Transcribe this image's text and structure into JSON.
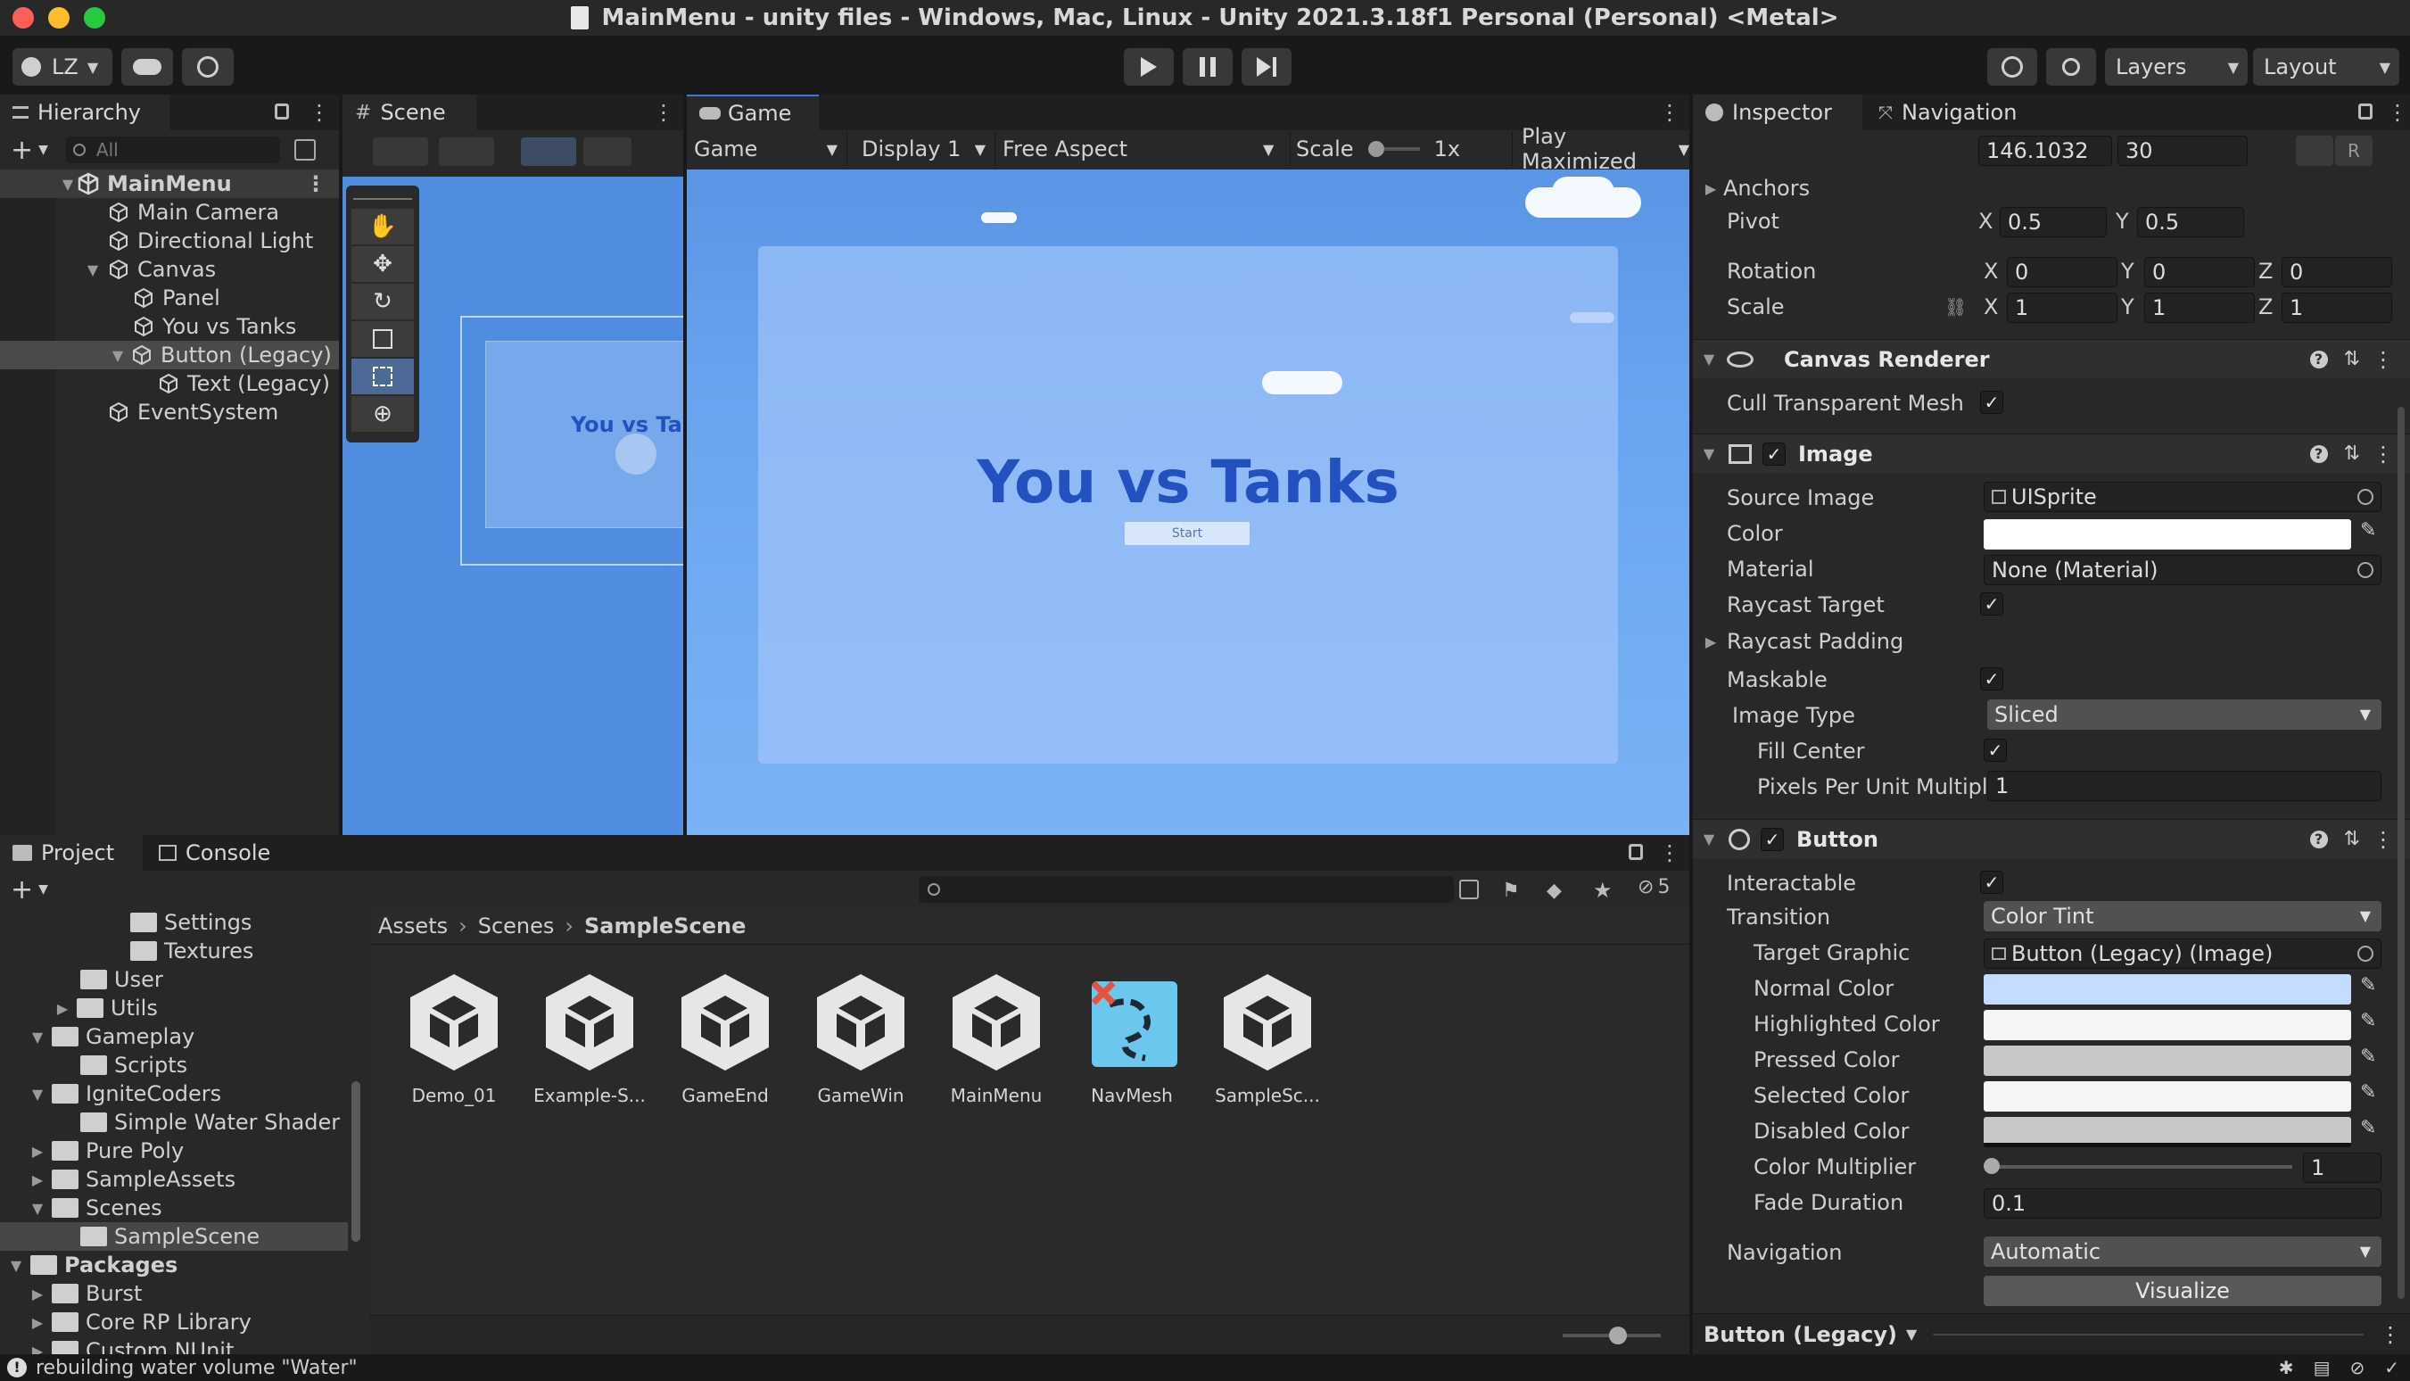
{
  "window": {
    "title": "MainMenu - unity files - Windows, Mac, Linux - Unity 2021.3.18f1 Personal (Personal) <Metal>"
  },
  "toolbar": {
    "account_label": "LZ",
    "layers_label": "Layers",
    "layout_label": "Layout"
  },
  "hierarchy": {
    "tab_label": "Hierarchy",
    "search_placeholder": "All",
    "items": [
      {
        "label": "MainMenu"
      },
      {
        "label": "Main Camera"
      },
      {
        "label": "Directional Light"
      },
      {
        "label": "Canvas"
      },
      {
        "label": "Panel"
      },
      {
        "label": "You vs Tanks"
      },
      {
        "label": "Button (Legacy)"
      },
      {
        "label": "Text (Legacy)"
      },
      {
        "label": "EventSystem"
      }
    ]
  },
  "scene": {
    "tab_label": "Scene",
    "preview_text": "You vs Tar"
  },
  "game": {
    "tab_label": "Game",
    "mode_dropdown": "Game",
    "display_dropdown": "Display 1",
    "aspect_dropdown": "Free Aspect",
    "scale_label": "Scale",
    "scale_value": "1x",
    "play_mode_dropdown": "Play Maximized",
    "ui_title": "You vs Tanks",
    "ui_button": "Start"
  },
  "project": {
    "tab_label": "Project",
    "console_tab_label": "Console",
    "hidden_count": "5",
    "folders": [
      {
        "label": "Settings"
      },
      {
        "label": "Textures"
      },
      {
        "label": "User"
      },
      {
        "label": "Utils"
      },
      {
        "label": "Gameplay"
      },
      {
        "label": "Scripts"
      },
      {
        "label": "IgniteCoders"
      },
      {
        "label": "Simple Water Shader"
      },
      {
        "label": "Pure Poly"
      },
      {
        "label": "SampleAssets"
      },
      {
        "label": "Scenes"
      },
      {
        "label": "SampleScene"
      },
      {
        "label": "Packages"
      },
      {
        "label": "Burst"
      },
      {
        "label": "Core RP Library"
      },
      {
        "label": "Custom NUnit"
      }
    ],
    "breadcrumb": [
      "Assets",
      "Scenes",
      "SampleScene"
    ],
    "assets": [
      {
        "label": "Demo_01",
        "icon": "unity-scene-icon"
      },
      {
        "label": "Example-S...",
        "icon": "unity-scene-icon"
      },
      {
        "label": "GameEnd",
        "icon": "unity-scene-icon"
      },
      {
        "label": "GameWin",
        "icon": "unity-scene-icon"
      },
      {
        "label": "MainMenu",
        "icon": "unity-scene-icon"
      },
      {
        "label": "NavMesh",
        "icon": "navmesh-icon"
      },
      {
        "label": "SampleSc...",
        "icon": "unity-scene-icon"
      }
    ]
  },
  "status_bar": {
    "message": "rebuilding water volume \"Water\""
  },
  "inspector": {
    "tab_label": "Inspector",
    "navigation_tab_label": "Navigation",
    "rect": {
      "width": "146.1032",
      "height": "30",
      "anchors_label": "Anchors",
      "pivot_label": "Pivot",
      "pivot_x": "0.5",
      "pivot_y": "0.5",
      "rotation_label": "Rotation",
      "rotation_x": "0",
      "rotation_y": "0",
      "rotation_z": "0",
      "scale_label": "Scale",
      "scale_x": "1",
      "scale_y": "1",
      "scale_z": "1",
      "r_label": "R"
    },
    "canvas_renderer": {
      "title": "Canvas Renderer",
      "cull_label": "Cull Transparent Mesh"
    },
    "image": {
      "title": "Image",
      "source_image_label": "Source Image",
      "source_image_value": "UISprite",
      "color_label": "Color",
      "material_label": "Material",
      "material_value": "None (Material)",
      "raycast_target_label": "Raycast Target",
      "raycast_padding_label": "Raycast Padding",
      "maskable_label": "Maskable",
      "image_type_label": "Image Type",
      "image_type_value": "Sliced",
      "fill_center_label": "Fill Center",
      "ppu_label": "Pixels Per Unit Multipli",
      "ppu_value": "1"
    },
    "button": {
      "title": "Button",
      "interactable_label": "Interactable",
      "transition_label": "Transition",
      "transition_value": "Color Tint",
      "target_graphic_label": "Target Graphic",
      "target_graphic_value": "Button (Legacy) (Image)",
      "normal_color_label": "Normal Color",
      "highlighted_color_label": "Highlighted Color",
      "pressed_color_label": "Pressed Color",
      "selected_color_label": "Selected Color",
      "disabled_color_label": "Disabled Color",
      "color_multiplier_label": "Color Multiplier",
      "color_multiplier_value": "1",
      "fade_duration_label": "Fade Duration",
      "fade_duration_value": "0.1",
      "navigation_label": "Navigation",
      "navigation_value": "Automatic",
      "visualize_label": "Visualize"
    },
    "footer_label": "Button (Legacy)"
  },
  "colors": {
    "normal": "#c4dcff",
    "highlighted": "#f5f5f5",
    "pressed": "#c8c8c8",
    "selected": "#f5f5f5",
    "disabled": "#c8c8c8",
    "sky": "#5a95e6",
    "title_blue": "#2451c0"
  }
}
